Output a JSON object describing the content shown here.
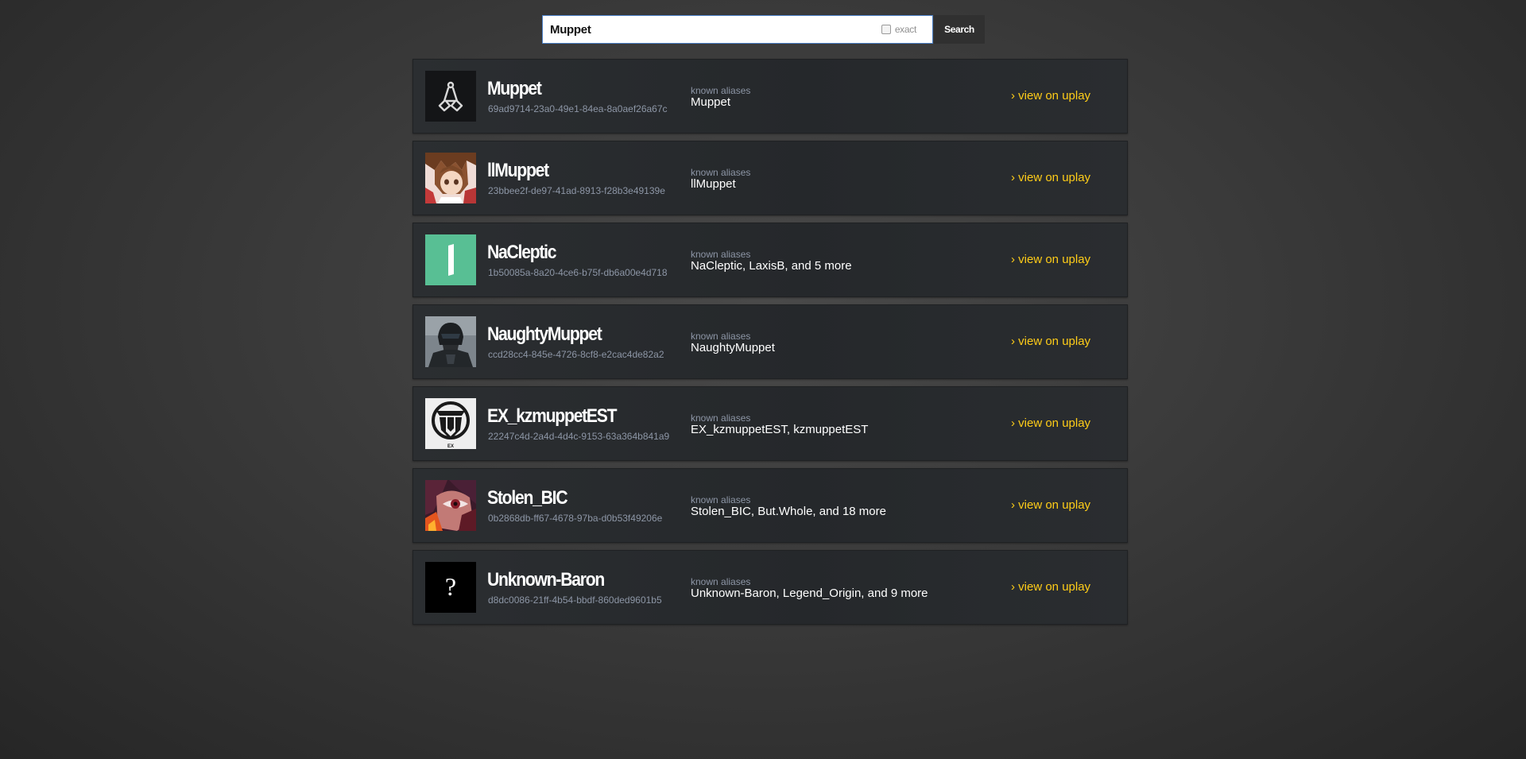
{
  "search": {
    "query": "Muppet",
    "exact_label": "exact",
    "button_label": "Search"
  },
  "accent_color": "#ffcd18",
  "results": [
    {
      "name": "Muppet",
      "id": "69ad9714-23a0-49e1-84ea-8a0aef26a67c",
      "aliases_label": "known aliases",
      "aliases": "Muppet",
      "link": "› view on uplay",
      "avatar": "muppet-logo-icon"
    },
    {
      "name": "llMuppet",
      "id": "23bbee2f-de97-41ad-8913-f28b3e49139e",
      "aliases_label": "known aliases",
      "aliases": "llMuppet",
      "link": "› view on uplay",
      "avatar": "anime-avatar"
    },
    {
      "name": "NaCleptic",
      "id": "1b50085a-8a20-4ce6-b75f-db6a00e4d718",
      "aliases_label": "known aliases",
      "aliases": "NaCleptic,  LaxisB,  and 5 more",
      "link": "› view on uplay",
      "avatar": "green-bar-avatar"
    },
    {
      "name": "NaughtyMuppet",
      "id": "ccd28cc4-845e-4726-8cf8-e2cac4de82a2",
      "aliases_label": "known aliases",
      "aliases": "NaughtyMuppet",
      "link": "› view on uplay",
      "avatar": "soldier-avatar"
    },
    {
      "name": "EX_kzmuppetEST",
      "id": "22247c4d-2a4d-4d4c-9153-63a364b841a9",
      "aliases_label": "known aliases",
      "aliases": "EX_kzmuppetEST,  kzmuppetEST",
      "link": "› view on uplay",
      "avatar": "emblem-avatar",
      "avatar_text": "EX"
    },
    {
      "name": "Stolen_BIC",
      "id": "0b2868db-ff67-4678-97ba-d0b53f49206e",
      "aliases_label": "known aliases",
      "aliases": "Stolen_BIC,  But.Whole,  and 18 more",
      "link": "› view on uplay",
      "avatar": "red-eye-avatar"
    },
    {
      "name": "Unknown-Baron",
      "id": "d8dc0086-21ff-4b54-bbdf-860ded9601b5",
      "aliases_label": "known aliases",
      "aliases": "Unknown-Baron,  Legend_Origin,  and 9 more",
      "link": "› view on uplay",
      "avatar": "question-mark-avatar",
      "avatar_text": "?"
    }
  ]
}
